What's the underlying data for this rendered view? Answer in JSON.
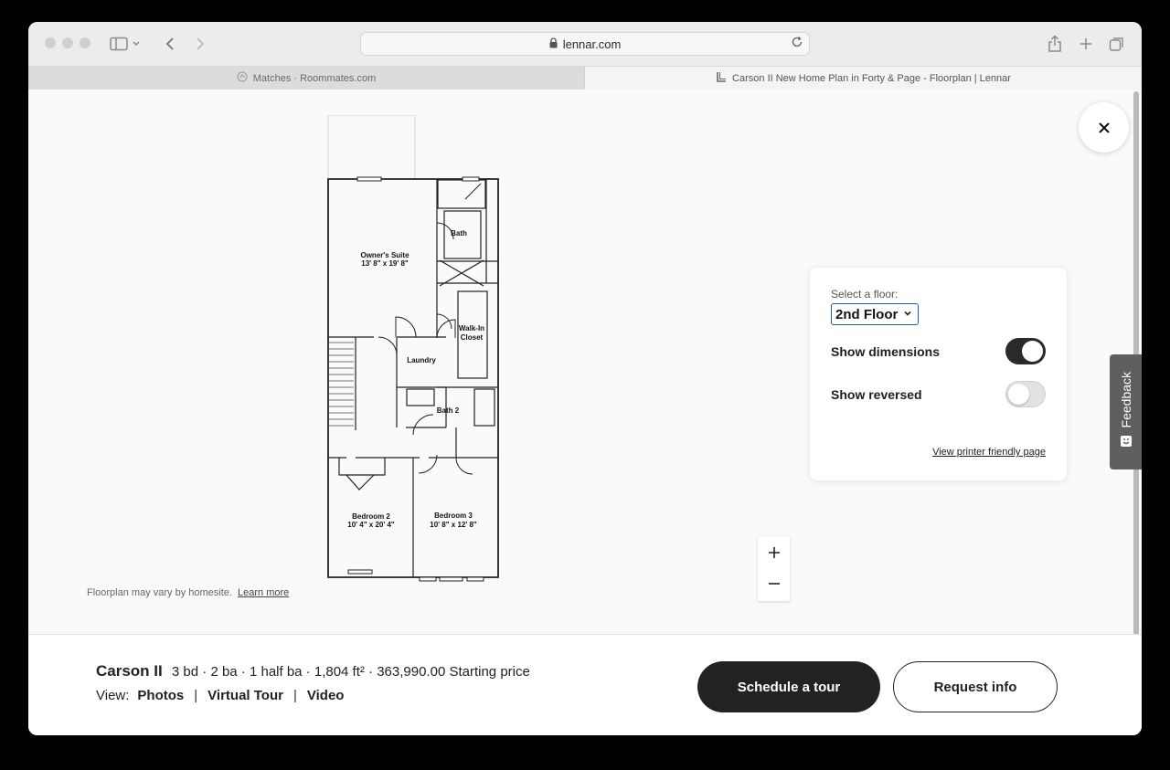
{
  "browser": {
    "url": "lennar.com",
    "tabs": [
      {
        "label": "Matches · Roommates.com",
        "active": false
      },
      {
        "label": "Carson II New Home Plan in Forty & Page - Floorplan | Lennar",
        "active": true
      }
    ]
  },
  "floorplan": {
    "rooms": [
      {
        "label": "Owner's Suite",
        "dims": "13' 8\" x 19' 8\""
      },
      {
        "label": "Bath",
        "dims": ""
      },
      {
        "label": "Walk-In",
        "dims": "Closet"
      },
      {
        "label": "Laundry",
        "dims": ""
      },
      {
        "label": "Bath 2",
        "dims": ""
      },
      {
        "label": "Bedroom 2",
        "dims": "10' 4\" x 20' 4\""
      },
      {
        "label": "Bedroom 3",
        "dims": "10' 8\" x 12' 8\""
      }
    ],
    "disclaimer": "Floorplan may vary by homesite.",
    "learn_more": "Learn more"
  },
  "floor_panel": {
    "select_label": "Select a floor:",
    "selected_floor": "2nd Floor",
    "show_dimensions_label": "Show dimensions",
    "show_dimensions": true,
    "show_reversed_label": "Show reversed",
    "show_reversed": false,
    "printer_link": "View printer friendly page"
  },
  "zoom": {
    "in": "+",
    "out": "—"
  },
  "feedback_label": "Feedback",
  "plan_info": {
    "name": "Carson II",
    "details": "3 bd · 2 ba · 1 half ba · 1,804 ft² · 363,990.00 Starting price",
    "view_label": "View:",
    "view_links": [
      "Photos",
      "Virtual Tour",
      "Video"
    ]
  },
  "actions": {
    "schedule": "Schedule a tour",
    "request": "Request info"
  },
  "colors": {
    "dark_button": "#222222",
    "toggle_on": "#2a2a2a",
    "toggle_off": "#e2e2e2",
    "select_border": "#1a5fb4"
  }
}
